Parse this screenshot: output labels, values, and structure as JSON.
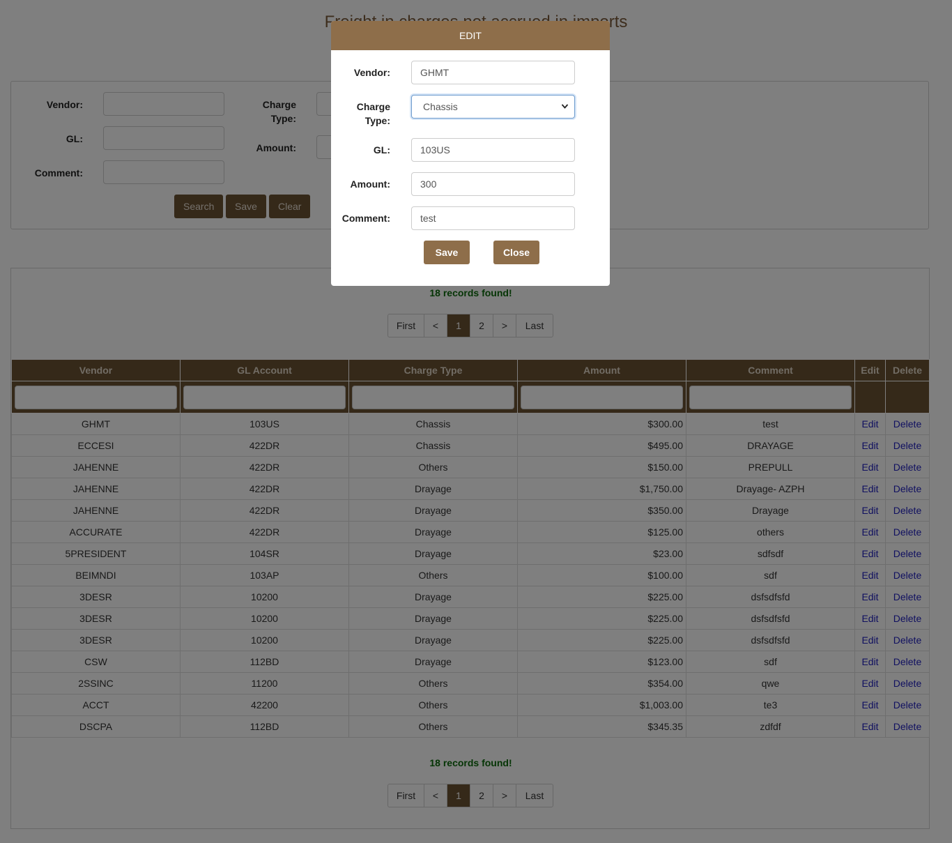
{
  "page": {
    "title": "Freight in charges not accrued in imports"
  },
  "search": {
    "vendor_label": "Vendor:",
    "charge_type_label_line1": "Charge",
    "charge_type_label_line2": "Type:",
    "gl_label": "GL:",
    "amount_label": "Amount:",
    "comment_label": "Comment:",
    "buttons": {
      "search": "Search",
      "save": "Save",
      "clear": "Clear"
    }
  },
  "results": {
    "records_found": "18 records found!",
    "pager": {
      "first": "First",
      "prev": "<",
      "pages": [
        "1",
        "2"
      ],
      "next": ">",
      "last": "Last",
      "current": "1"
    },
    "columns": [
      "Vendor",
      "GL Account",
      "Charge Type",
      "Amount",
      "Comment",
      "Edit",
      "Delete"
    ],
    "rows": [
      {
        "vendor": "GHMT",
        "gl": "103US",
        "charge_type": "Chassis",
        "amount": "$300.00",
        "comment": "test",
        "edit": "Edit",
        "delete": "Delete"
      },
      {
        "vendor": "ECCESI",
        "gl": "422DR",
        "charge_type": "Chassis",
        "amount": "$495.00",
        "comment": "DRAYAGE",
        "edit": "Edit",
        "delete": "Delete"
      },
      {
        "vendor": "JAHENNE",
        "gl": "422DR",
        "charge_type": "Others",
        "amount": "$150.00",
        "comment": "PREPULL",
        "edit": "Edit",
        "delete": "Delete"
      },
      {
        "vendor": "JAHENNE",
        "gl": "422DR",
        "charge_type": "Drayage",
        "amount": "$1,750.00",
        "comment": "Drayage- AZPH",
        "edit": "Edit",
        "delete": "Delete"
      },
      {
        "vendor": "JAHENNE",
        "gl": "422DR",
        "charge_type": "Drayage",
        "amount": "$350.00",
        "comment": "Drayage",
        "edit": "Edit",
        "delete": "Delete"
      },
      {
        "vendor": "ACCURATE",
        "gl": "422DR",
        "charge_type": "Drayage",
        "amount": "$125.00",
        "comment": "others",
        "edit": "Edit",
        "delete": "Delete"
      },
      {
        "vendor": "5PRESIDENT",
        "gl": "104SR",
        "charge_type": "Drayage",
        "amount": "$23.00",
        "comment": "sdfsdf",
        "edit": "Edit",
        "delete": "Delete"
      },
      {
        "vendor": "BEIMNDI",
        "gl": "103AP",
        "charge_type": "Others",
        "amount": "$100.00",
        "comment": "sdf",
        "edit": "Edit",
        "delete": "Delete"
      },
      {
        "vendor": "3DESR",
        "gl": "10200",
        "charge_type": "Drayage",
        "amount": "$225.00",
        "comment": "dsfsdfsfd",
        "edit": "Edit",
        "delete": "Delete"
      },
      {
        "vendor": "3DESR",
        "gl": "10200",
        "charge_type": "Drayage",
        "amount": "$225.00",
        "comment": "dsfsdfsfd",
        "edit": "Edit",
        "delete": "Delete"
      },
      {
        "vendor": "3DESR",
        "gl": "10200",
        "charge_type": "Drayage",
        "amount": "$225.00",
        "comment": "dsfsdfsfd",
        "edit": "Edit",
        "delete": "Delete"
      },
      {
        "vendor": "CSW",
        "gl": "112BD",
        "charge_type": "Drayage",
        "amount": "$123.00",
        "comment": "sdf",
        "edit": "Edit",
        "delete": "Delete"
      },
      {
        "vendor": "2SSINC",
        "gl": "11200",
        "charge_type": "Others",
        "amount": "$354.00",
        "comment": "qwe",
        "edit": "Edit",
        "delete": "Delete"
      },
      {
        "vendor": "ACCT",
        "gl": "42200",
        "charge_type": "Others",
        "amount": "$1,003.00",
        "comment": "te3",
        "edit": "Edit",
        "delete": "Delete"
      },
      {
        "vendor": "DSCPA",
        "gl": "112BD",
        "charge_type": "Others",
        "amount": "$345.35",
        "comment": "zdfdf",
        "edit": "Edit",
        "delete": "Delete"
      }
    ]
  },
  "modal": {
    "title": "EDIT",
    "vendor_label": "Vendor:",
    "vendor_value": "GHMT",
    "charge_type_label_line1": "Charge",
    "charge_type_label_line2": "Type:",
    "charge_type_value": "Chassis",
    "gl_label": "GL:",
    "gl_value": "103US",
    "amount_label": "Amount:",
    "amount_value": "300",
    "comment_label": "Comment:",
    "comment_value": "test",
    "save_label": "Save",
    "close_label": "Close"
  },
  "colors": {
    "header_brown": "#6b5233",
    "modal_header_brown": "#8e6e4a",
    "records_found_green": "#0c6b0c",
    "link_blue": "#2020c0"
  }
}
